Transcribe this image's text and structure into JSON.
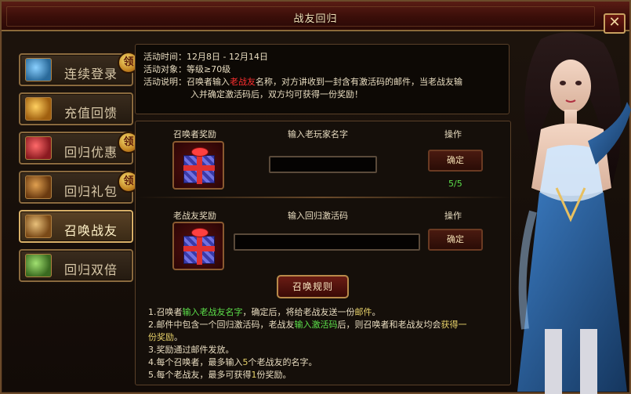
{
  "window": {
    "title": "战友回归",
    "close_label": "✕"
  },
  "sidebar": {
    "items": [
      {
        "label": "连续登录",
        "icon": "calendar-login-icon",
        "badge": "领",
        "active": false
      },
      {
        "label": "充值回馈",
        "icon": "treasure-bag-icon",
        "badge": "",
        "active": false
      },
      {
        "label": "回归优惠",
        "icon": "gift-pack-icon",
        "badge": "领",
        "active": false
      },
      {
        "label": "回归礼包",
        "icon": "treasure-chest-icon",
        "badge": "领",
        "active": false
      },
      {
        "label": "召唤战友",
        "icon": "summon-scroll-icon",
        "badge": "",
        "active": true
      },
      {
        "label": "回归双倍",
        "icon": "double-scroll-icon",
        "badge": "",
        "active": false
      }
    ]
  },
  "info": {
    "time_label": "活动时间：",
    "time_value": "12月8日 - 12月14日",
    "target_label": "活动对象：",
    "target_value": "等级≥70级",
    "desc_label": "活动说明：",
    "desc_pre": "召唤者输入",
    "desc_highlight": "老战友",
    "desc_post": "名称，对方讲收到一封含有激活码的邮件，当老战友输",
    "desc_line2": "入并确定激活码后，双方均可获得一份奖励！"
  },
  "summoner_row": {
    "reward_label": "召唤者奖励",
    "input_label": "输入老玩家名字",
    "action_label": "操作",
    "input_value": "",
    "button_label": "确定",
    "count": "5/5"
  },
  "veteran_row": {
    "reward_label": "老战友奖励",
    "input_label": "输入回归激活码",
    "action_label": "操作",
    "input_value": "",
    "button_label": "确定"
  },
  "rules": {
    "title": "召唤规则",
    "r1_a": "1.召唤者",
    "r1_b": "输入老战友名字",
    "r1_c": "，确定后，将给老战友送一份",
    "r1_d": "邮件",
    "r1_e": "。",
    "r2_a": "2.邮件中包含一个回归激活码，老战友",
    "r2_b": "输入激活码",
    "r2_c": "后，则召唤者和老战友均会",
    "r2_d": "获得一",
    "r2_e": "份奖励",
    "r2_f": "。",
    "r3": "3.奖励通过邮件发放。",
    "r4_a": "4.每个召唤者，最多输入",
    "r4_b": "5",
    "r4_c": "个老战友的名字。",
    "r5_a": "5.每个老战友，最多可获得",
    "r5_b": "1",
    "r5_c": "份奖励。"
  },
  "colors": {
    "highlight_red": "#ff3030",
    "highlight_green": "#5ce04a",
    "highlight_yellow": "#e8d26a"
  }
}
